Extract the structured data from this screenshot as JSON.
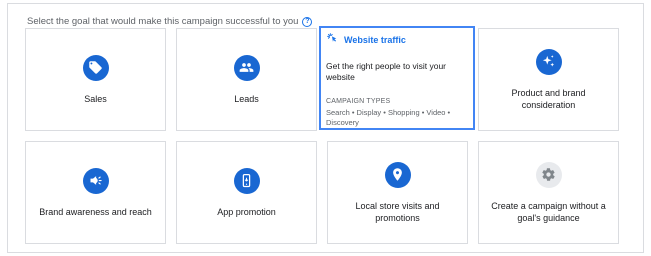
{
  "prompt": {
    "text": "Select the goal that would make this campaign successful to you",
    "help_icon": "?"
  },
  "goals": [
    {
      "label": "Sales",
      "icon": "tag-icon"
    },
    {
      "label": "Leads",
      "icon": "people-icon"
    },
    {
      "label": "Website traffic",
      "icon": "cursor-click-icon",
      "selected": true,
      "description": "Get the right people to visit your website",
      "types_heading": "CAMPAIGN TYPES",
      "types": "Search • Display • Shopping • Video • Discovery"
    },
    {
      "label": "Product and brand consideration",
      "icon": "sparkle-icon"
    },
    {
      "label": "Brand awareness and reach",
      "icon": "megaphone-icon"
    },
    {
      "label": "App promotion",
      "icon": "phone-icon"
    },
    {
      "label": "Local store visits and promotions",
      "icon": "location-pin-icon"
    },
    {
      "label": "Create a campaign without a goal's guidance",
      "icon": "gear-icon"
    }
  ],
  "colors": {
    "accent": "#1967d2",
    "selected_border": "#4285f4",
    "border": "#dadce0"
  }
}
